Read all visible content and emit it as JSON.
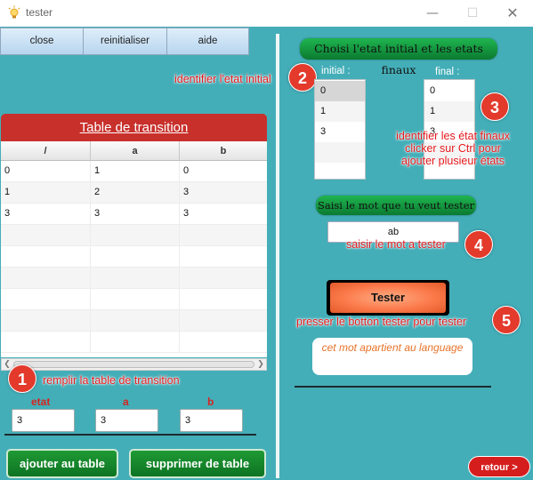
{
  "window": {
    "title": "tester",
    "controls": {
      "minimize": "—",
      "maximize": "☐",
      "close": "✕"
    }
  },
  "toolbar": {
    "close_label": "close",
    "reset_label": "reinitialiser",
    "help_label": "aide"
  },
  "table": {
    "title": "Table de transition",
    "columns": [
      "/",
      "a",
      "b"
    ],
    "rows": [
      [
        "0",
        "1",
        "0"
      ],
      [
        "1",
        "2",
        "3"
      ],
      [
        "3",
        "3",
        "3"
      ]
    ]
  },
  "inputs": {
    "etat_label": "etat",
    "a_label": "a",
    "b_label": "b",
    "etat_value": "3",
    "a_value": "3",
    "b_value": "3"
  },
  "actions": {
    "add_label": "ajouter au table",
    "delete_label": "supprimer de table"
  },
  "right": {
    "choose_header": "Choisi l'etat initial et les etats finaux",
    "initial_label": "initial :",
    "final_label": "final :",
    "initial_items": [
      "0",
      "1",
      "3"
    ],
    "final_items": [
      "0",
      "1",
      "3"
    ],
    "word_header": "Saisi le mot que tu veut tester",
    "word_value": "ab",
    "tester_label": "Tester",
    "result_text": "cet mot apartient au language",
    "back_label": "retour >"
  },
  "annotations": {
    "n1": "1",
    "t1": "remplir la table de transition",
    "n2": "2",
    "t2": "identifier l'etat initial",
    "n3": "3",
    "t3": "identifier les état finaux clicker sur Ctrl pour ajouter plusieur états",
    "n4": "4",
    "t4": "saisir le mot a tester",
    "n5": "5",
    "t5": "presser le botton tester pour tester"
  },
  "colors": {
    "background": "#44aeb8",
    "table_header": "#c8302c",
    "annotation_red": "#e4181c",
    "green_button": "#1a8f30",
    "tester_orange": "#fb7a4b",
    "result_text": "#e9732a"
  },
  "icons": {
    "app_icon": "lightbulb-icon"
  }
}
